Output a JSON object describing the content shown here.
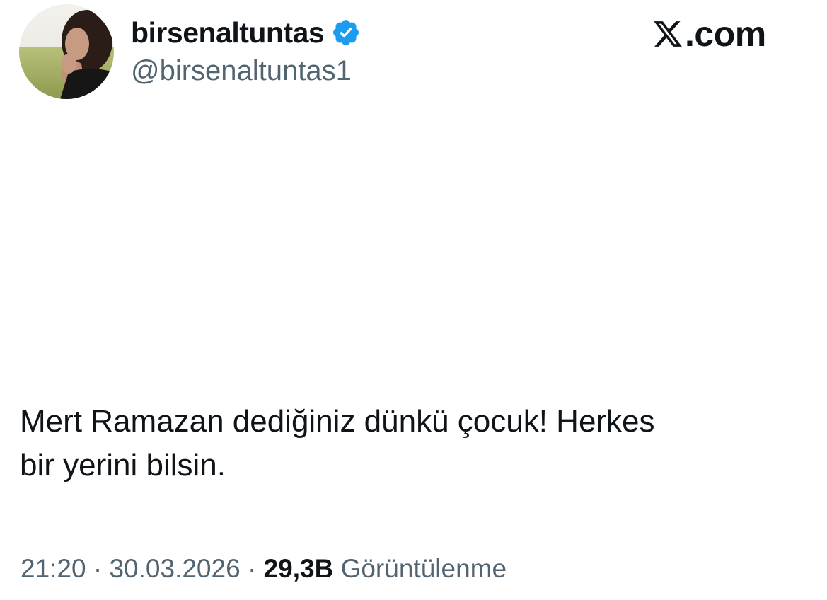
{
  "author": {
    "display_name": "birsenaltuntas",
    "handle": "@birsenaltuntas1",
    "verified": true,
    "verified_color": "#1d9bf0"
  },
  "brand": {
    "logo_icon": "x-logo-icon",
    "text": ".com"
  },
  "tweet": {
    "text_lines": [
      "Mert Ramazan dediğiniz dünkü çocuk! Herkes",
      "bir yerini bilsin."
    ],
    "time": "21:20",
    "separator": "·",
    "date": "30.03.2026",
    "views_count": "29,3B",
    "views_label": "Görüntülenme"
  },
  "colors": {
    "text_primary": "#0f1419",
    "text_secondary": "#536471",
    "background": "#ffffff"
  }
}
